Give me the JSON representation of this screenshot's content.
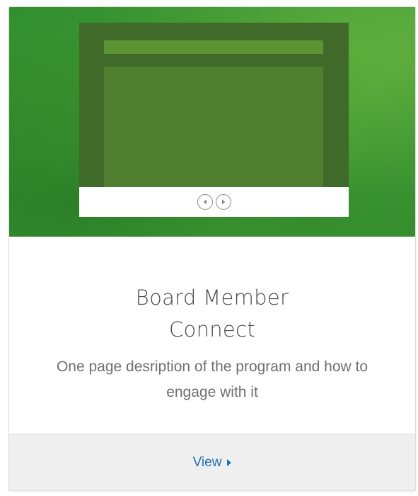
{
  "card": {
    "title": "Board Member Connect",
    "description": "One page desription of the program and how to engage with it",
    "view_label": "View",
    "view_icon": "caret-right-icon"
  },
  "hero": {
    "icons": [
      "slideshow-mockup-icon",
      "prev-arrow-icon",
      "next-arrow-icon"
    ]
  },
  "colors": {
    "hero_green": "#3c9a35",
    "frame_dark": "#3f6a2a",
    "bar_green": "#5c9333",
    "link_blue": "#1f72ae",
    "footer_bg": "#efefef"
  }
}
